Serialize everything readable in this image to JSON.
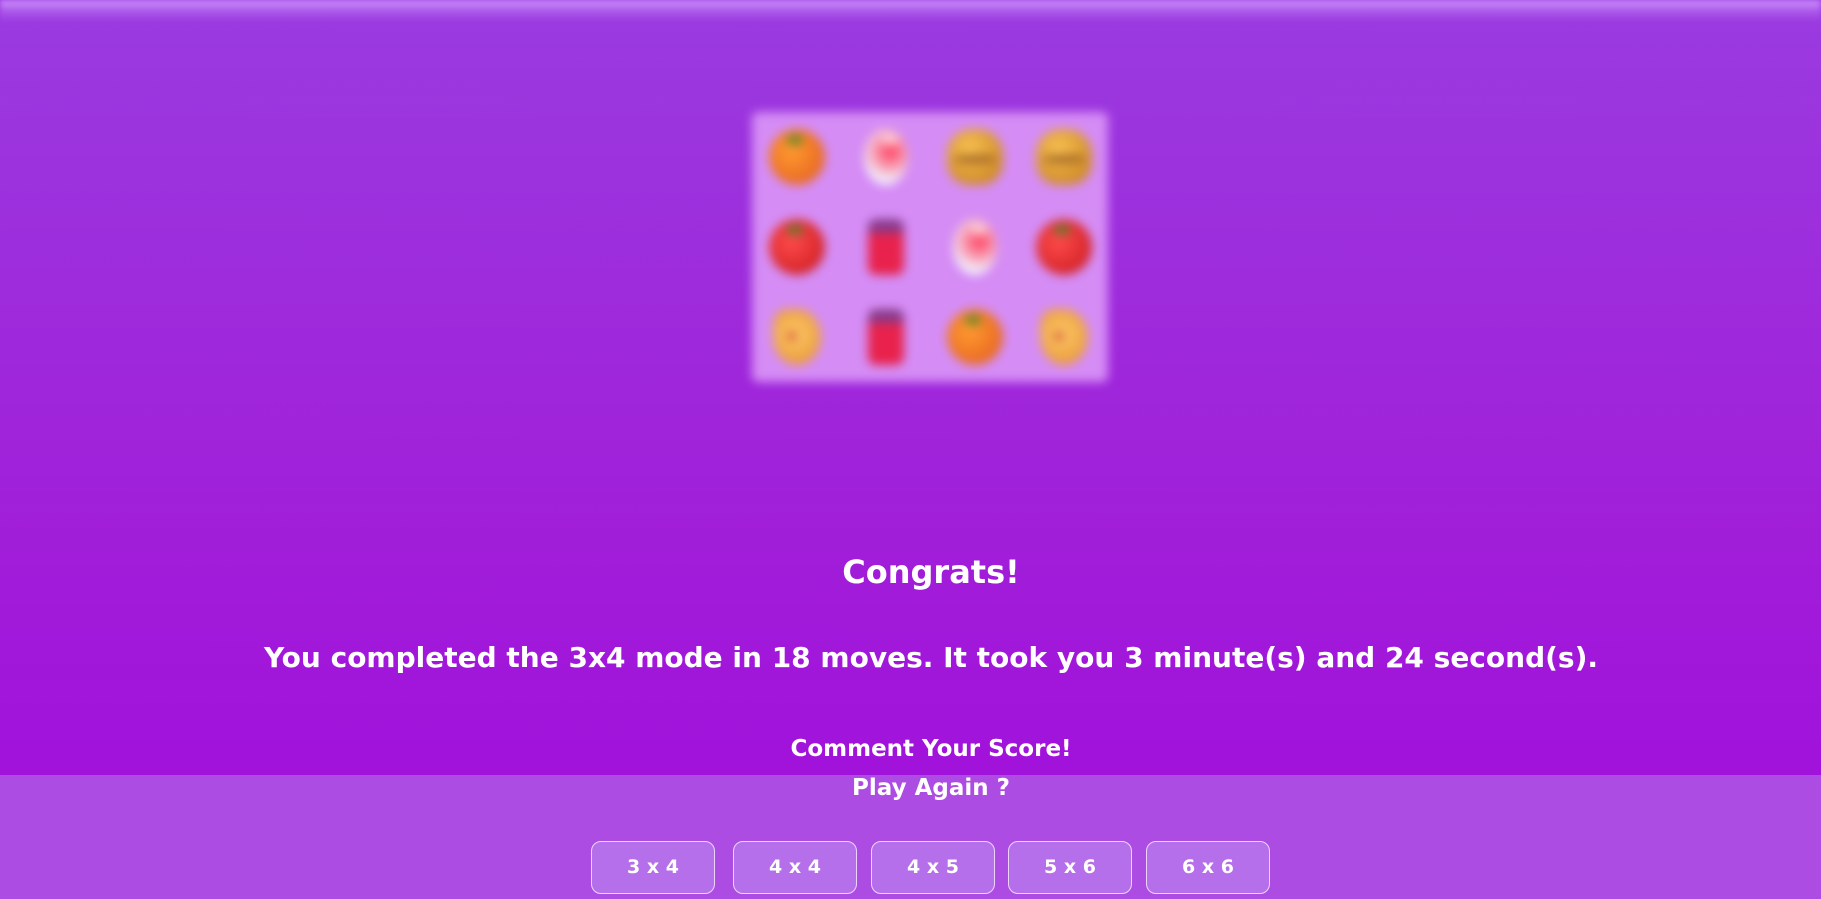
{
  "result": {
    "title": "Congrats!",
    "summary": "You completed the 3x4 mode in 18 moves. It took you 3 minute(s) and 24 second(s).",
    "comment_prompt": "Comment Your Score!",
    "play_again_prompt": "Play Again ?"
  },
  "board": {
    "mode": "3x4",
    "blurred": true,
    "tiles": [
      "orange",
      "candy",
      "burger",
      "burger",
      "strawberry",
      "jam-jar",
      "candy",
      "strawberry",
      "pizza",
      "jam-jar",
      "orange",
      "pizza"
    ]
  },
  "modes": [
    "3 x 4",
    "4 x 4",
    "4 x 5",
    "5 x 6",
    "6 x 6"
  ],
  "colors": {
    "background_top": "#9a3be0",
    "background_bottom": "#a10bdc",
    "bottom_bar": "#ad4ce2",
    "button_fill": "#b66fea",
    "board_fill": "#d58cf5"
  }
}
